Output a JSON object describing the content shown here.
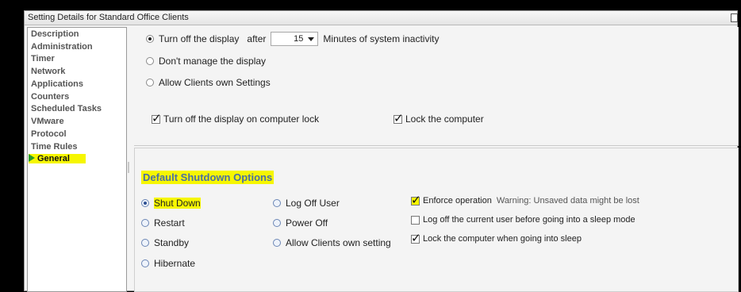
{
  "window": {
    "title": "Setting Details for Standard Office Clients"
  },
  "sidebar": {
    "items": [
      {
        "label": "Description"
      },
      {
        "label": "Administration"
      },
      {
        "label": "Timer"
      },
      {
        "label": "Network"
      },
      {
        "label": "Applications"
      },
      {
        "label": "Counters"
      },
      {
        "label": "Scheduled Tasks"
      },
      {
        "label": "VMware"
      },
      {
        "label": "Protocol"
      },
      {
        "label": "Time Rules"
      },
      {
        "label": "General",
        "active": true
      }
    ]
  },
  "display": {
    "turn_off_label": "Turn off the display",
    "after_label": "after",
    "minutes_value": "15",
    "minutes_suffix": "Minutes of system inactivity",
    "dont_manage_label": "Don't manage the display",
    "allow_clients_label": "Allow Clients own Settings",
    "turn_off_on_lock_label": "Turn off the display on computer lock",
    "lock_computer_label": "Lock the computer"
  },
  "shutdown": {
    "section_title": "Default Shutdown Options",
    "options_col1": [
      "Shut Down",
      "Restart",
      "Standby",
      "Hibernate"
    ],
    "options_col2": [
      "Log Off User",
      "Power Off",
      "Allow Clients own setting"
    ],
    "enforce_label": "Enforce operation",
    "warning_text": "Warning: Unsaved data might be lost",
    "logoff_before_sleep_label": "Log off the current user before going into a sleep mode",
    "lock_when_sleep_label": "Lock the computer when going into sleep"
  }
}
